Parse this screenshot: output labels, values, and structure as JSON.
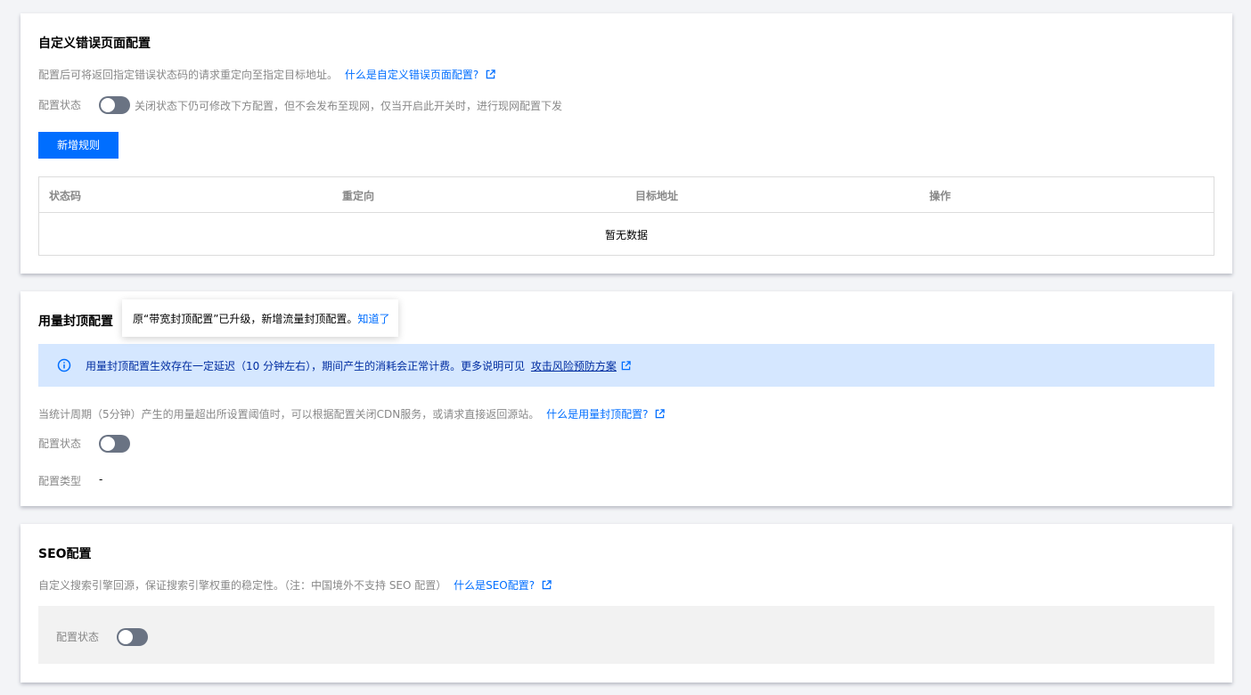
{
  "error_page": {
    "title": "自定义错误页面配置",
    "description": "配置后可将返回指定错误状态码的请求重定向至指定目标地址。",
    "help_link": "什么是自定义错误页面配置?",
    "status_label": "配置状态",
    "toggle_on": false,
    "status_hint": "关闭状态下仍可修改下方配置，但不会发布至现网，仅当开启此开关时，进行现网配置下发",
    "add_button": "新增规则",
    "table": {
      "columns": [
        "状态码",
        "重定向",
        "目标地址",
        "操作"
      ],
      "rows": [],
      "empty_text": "暂无数据"
    }
  },
  "usage_cap": {
    "title": "用量封顶配置",
    "tooltip_text": "原“带宽封顶配置”已升级，新增流量封顶配置。",
    "tooltip_link": "知道了",
    "notice_text": "用量封顶配置生效存在一定延迟（10 分钟左右），期间产生的消耗会正常计费。更多说明可见",
    "notice_link": "攻击风险预防方案",
    "description": "当统计周期（5分钟）产生的用量超出所设置阈值时，可以根据配置关闭CDN服务，或请求直接返回源站。",
    "help_link": "什么是用量封顶配置?",
    "status_label": "配置状态",
    "toggle_on": false,
    "type_label": "配置类型",
    "type_value": "-"
  },
  "seo": {
    "title": "SEO配置",
    "description": "自定义搜索引擎回源，保证搜索引擎权重的稳定性。（注：中国境外不支持 SEO 配置）",
    "help_link": "什么是SEO配置?",
    "status_label": "配置状态",
    "toggle_on": false
  },
  "colors": {
    "accent": "#006eff",
    "toggle_off": "#6a7383",
    "notice_bg": "#d5e7ff",
    "notice_text": "#002da0",
    "page_bg": "#f3f4f7"
  },
  "icons": {
    "external_link": "external-link-icon",
    "info": "info-circle-icon"
  }
}
